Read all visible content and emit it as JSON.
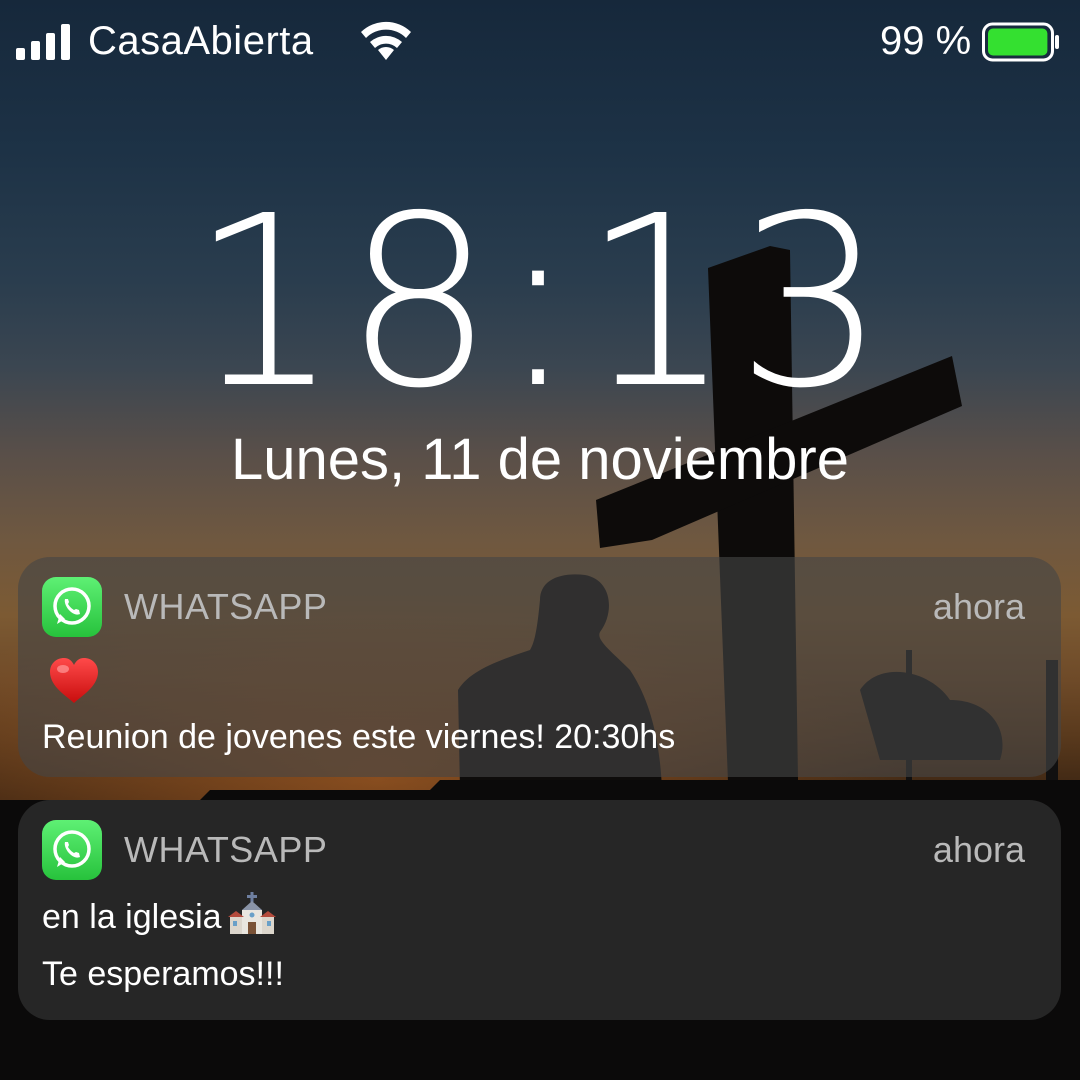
{
  "status_bar": {
    "carrier": "CasaAbierta",
    "battery_percent": "99 %",
    "battery_level": 0.99,
    "battery_color": "#34e030",
    "signal_icon": "signal-bars-icon",
    "wifi_icon": "wifi-icon"
  },
  "lock_screen": {
    "time": "18:13",
    "date": "Lunes, 11 de noviembre"
  },
  "notifications": [
    {
      "app": "WHATSAPP",
      "time": "ahora",
      "icon": "whatsapp-icon",
      "emoji_icon": "red-heart-icon",
      "lines": [
        "Reunion de jovenes este viernes! 20:30hs"
      ]
    },
    {
      "app": "WHATSAPP",
      "time": "ahora",
      "icon": "whatsapp-icon",
      "lines": [
        "en la iglesia",
        "Te esperamos!!!"
      ],
      "emoji_icon": "church-icon"
    }
  ]
}
